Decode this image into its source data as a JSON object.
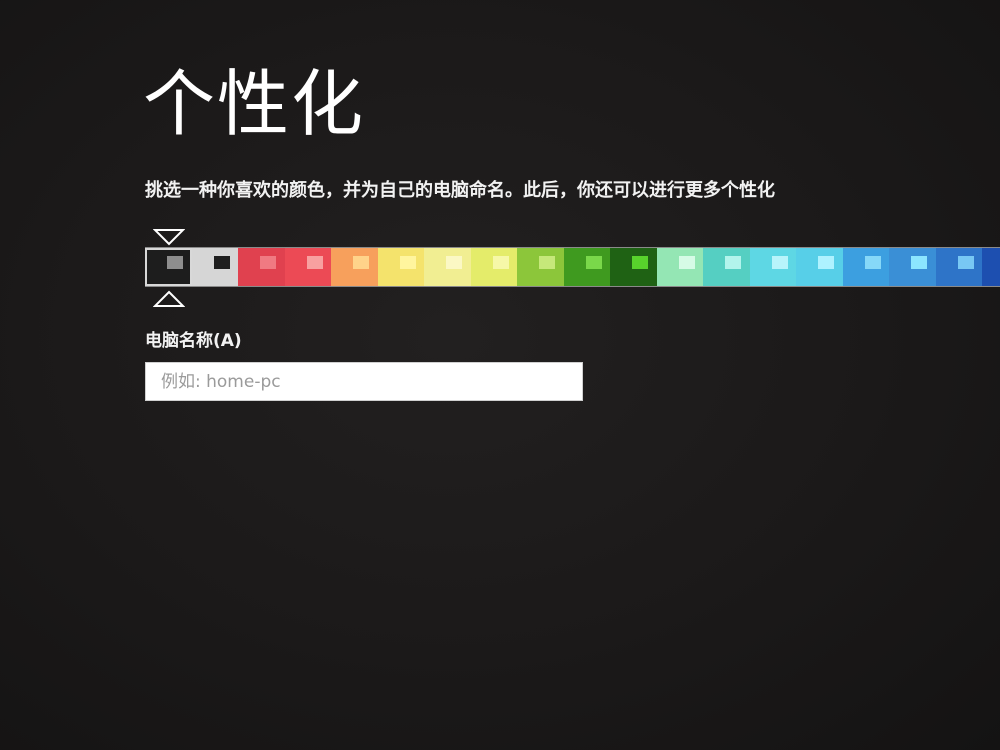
{
  "page": {
    "title": "个性化",
    "subtitle": "挑选一种你喜欢的颜色，并为自己的电脑命名。此后，你还可以进行更多个性化"
  },
  "color_picker": {
    "selected_index": 0,
    "swatches": [
      {
        "bg": "#1d1d1d",
        "accent": "#8e8e8e"
      },
      {
        "bg": "#d6d6d6",
        "accent": "#1e1e1e"
      },
      {
        "bg": "#e0414f",
        "accent": "#f07a82"
      },
      {
        "bg": "#ec4a55",
        "accent": "#f8a0a0"
      },
      {
        "bg": "#f7a05c",
        "accent": "#ffd38a"
      },
      {
        "bg": "#f4e36c",
        "accent": "#fff59e"
      },
      {
        "bg": "#f1ee92",
        "accent": "#fbf8c4"
      },
      {
        "bg": "#e4ec6a",
        "accent": "#f6f8a8"
      },
      {
        "bg": "#8cc63a",
        "accent": "#c6e87a"
      },
      {
        "bg": "#3f9a1f",
        "accent": "#7ad84a"
      },
      {
        "bg": "#1f6214",
        "accent": "#58d22c"
      },
      {
        "bg": "#94e6b4",
        "accent": "#d6fbe6"
      },
      {
        "bg": "#55cfc2",
        "accent": "#b2f4ec"
      },
      {
        "bg": "#5ed7e4",
        "accent": "#b8f4fb"
      },
      {
        "bg": "#57cfe8",
        "accent": "#aef2ff"
      },
      {
        "bg": "#3c9fe0",
        "accent": "#86d8f8"
      },
      {
        "bg": "#3a8fd6",
        "accent": "#8ce6ff"
      },
      {
        "bg": "#2e74c8",
        "accent": "#78c8f4"
      },
      {
        "bg": "#1d4fb0",
        "accent": "#5a9ee8"
      }
    ]
  },
  "pc_name": {
    "label": "电脑名称(A)",
    "value": "",
    "placeholder": "例如: home-pc"
  }
}
